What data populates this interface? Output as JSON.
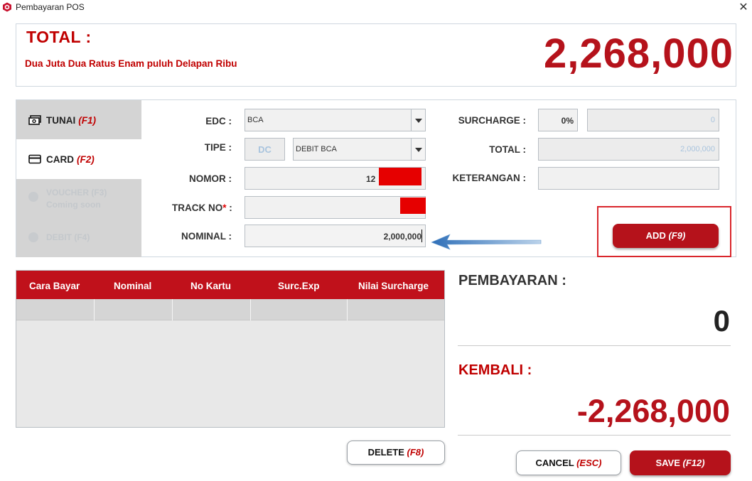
{
  "window": {
    "title": "Pembayaran POS",
    "close_glyph": "✕"
  },
  "total": {
    "label": "TOTAL :",
    "words": "Dua Juta Dua Ratus Enam puluh Delapan Ribu",
    "amount": "2,268,000"
  },
  "tabs": [
    {
      "label": "TUNAI",
      "key": "(F1)",
      "icon": "cash-icon"
    },
    {
      "label": "CARD",
      "key": "(F2)",
      "icon": "card-icon",
      "active": true
    },
    {
      "label_line1": "VOUCHER (F3)",
      "label_line2": "Coming soon",
      "icon": "voucher-icon",
      "disabled": true
    },
    {
      "label": "DEBIT (F4)",
      "icon": "debit-icon",
      "disabled": true
    }
  ],
  "form": {
    "edc_label": "EDC :",
    "edc_value": "BCA",
    "tipe_label": "TIPE :",
    "tipe_code": "DC",
    "tipe_value": "DEBIT BCA",
    "nomor_label": "NOMOR :",
    "nomor_value": "12",
    "track_label": "TRACK NO",
    "track_required": "*",
    "track_colon": " :",
    "nominal_label": "NOMINAL :",
    "nominal_value": "2,000,000",
    "surcharge_label": "SURCHARGE :",
    "surcharge_pct": "0%",
    "surcharge_value": "0",
    "total_label": "TOTAL :",
    "total_value": "2,000,000",
    "keterangan_label": "KETERANGAN :",
    "keterangan_value": ""
  },
  "buttons": {
    "add": {
      "label": "ADD",
      "key": "(F9)"
    },
    "delete": {
      "label": "DELETE",
      "key": "(F8)"
    },
    "cancel": {
      "label": "CANCEL",
      "key": "(ESC)"
    },
    "save": {
      "label": "SAVE",
      "key": "(F12)"
    }
  },
  "grid": {
    "columns": [
      "Cara Bayar",
      "Nominal",
      "No Kartu",
      "Surc.Exp",
      "Nilai Surcharge"
    ]
  },
  "summary": {
    "pembayaran_label": "PEMBAYARAN :",
    "pembayaran_value": "0",
    "kembali_label": "KEMBALI :",
    "kembali_value": "-2,268,000"
  },
  "colors": {
    "brand_red": "#b5121b",
    "accent_red": "#c00000",
    "highlight_frame": "#d9262c",
    "redaction": "#e60000",
    "arrow_blue": "#3d7fc4"
  }
}
